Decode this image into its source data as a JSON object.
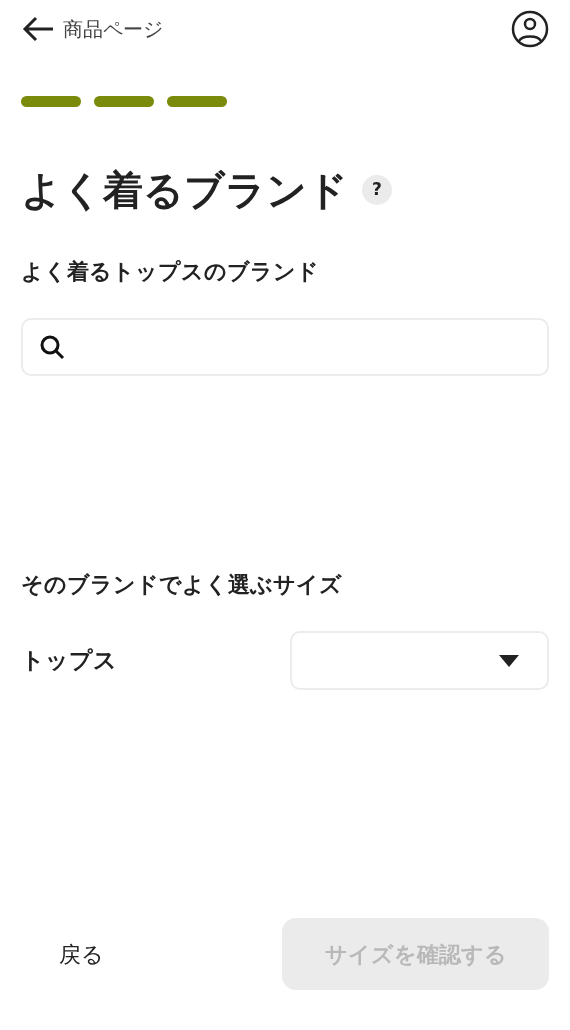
{
  "header": {
    "back_label": "商品ページ"
  },
  "progress_steps": [
    {
      "done": true
    },
    {
      "done": true
    },
    {
      "done": true
    }
  ],
  "title": "よく着るブランド",
  "help": "?",
  "brand_section": {
    "label": "よく着るトップスのブランド"
  },
  "size_section": {
    "title": "そのブランドでよく選ぶサイズ",
    "rows": [
      {
        "label": "トップス"
      }
    ]
  },
  "footer": {
    "back": "戻る",
    "confirm": {
      "label": "サイズを確認する",
      "disabled": true
    }
  }
}
